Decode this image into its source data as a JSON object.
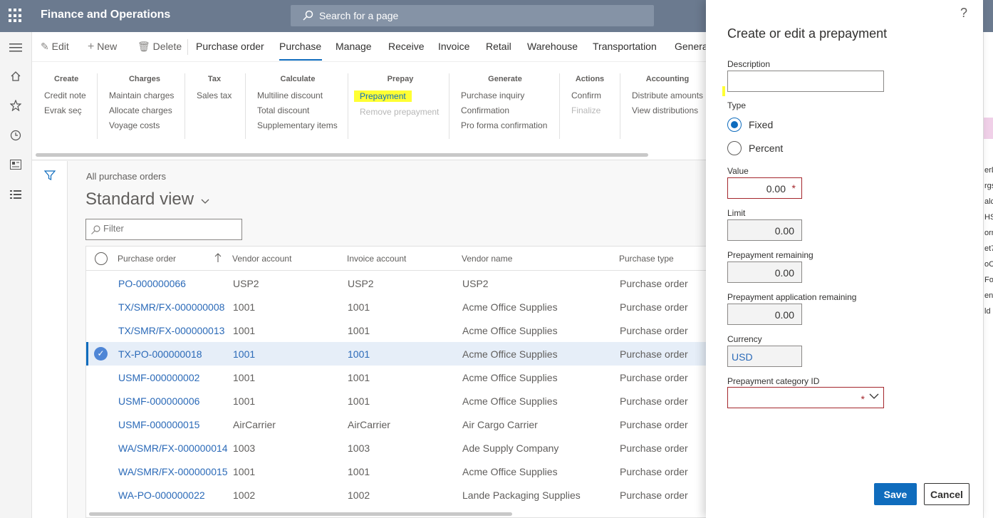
{
  "header": {
    "app_title": "Finance and Operations",
    "search_placeholder": "Search for a page"
  },
  "commands": [
    {
      "label": "Edit"
    },
    {
      "label": "New"
    },
    {
      "label": "Delete"
    }
  ],
  "tabs": [
    {
      "label": "Purchase order"
    },
    {
      "label": "Purchase"
    },
    {
      "label": "Manage"
    },
    {
      "label": "Receive"
    },
    {
      "label": "Invoice"
    },
    {
      "label": "Retail"
    },
    {
      "label": "Warehouse"
    },
    {
      "label": "Transportation"
    },
    {
      "label": "Genera"
    }
  ],
  "groups": [
    {
      "title": "Create",
      "items": [
        "Credit note",
        "Evrak seç"
      ]
    },
    {
      "title": "Charges",
      "items": [
        "Maintain charges",
        "Allocate charges",
        "Voyage costs"
      ]
    },
    {
      "title": "Tax",
      "items": [
        "Sales tax"
      ]
    },
    {
      "title": "Calculate",
      "items": [
        "Multiline discount",
        "Total discount",
        "Supplementary items"
      ]
    },
    {
      "title": "Prepay",
      "items": [
        "Prepayment",
        "Remove prepayment"
      ]
    },
    {
      "title": "Generate",
      "items": [
        "Purchase inquiry",
        "Confirmation",
        "Pro forma confirmation"
      ]
    },
    {
      "title": "Actions",
      "items": [
        "Confirm",
        "Finalize"
      ]
    },
    {
      "title": "Accounting",
      "items": [
        "Distribute amounts",
        "View distributions"
      ]
    }
  ],
  "list": {
    "breadcrumb": "All purchase orders",
    "view_title": "Standard view",
    "filter_placeholder": "Filter",
    "columns": [
      "Purchase order",
      "Vendor account",
      "Invoice account",
      "Vendor name",
      "Purchase type"
    ],
    "rows": [
      [
        "PO-000000066",
        "USP2",
        "USP2",
        "USP2",
        "Purchase order"
      ],
      [
        "TX/SMR/FX-000000008",
        "1001",
        "1001",
        "Acme Office Supplies",
        "Purchase order"
      ],
      [
        "TX/SMR/FX-000000013",
        "1001",
        "1001",
        "Acme Office Supplies",
        "Purchase order"
      ],
      [
        "TX-PO-000000018",
        "1001",
        "1001",
        "Acme Office Supplies",
        "Purchase order"
      ],
      [
        "USMF-000000002",
        "1001",
        "1001",
        "Acme Office Supplies",
        "Purchase order"
      ],
      [
        "USMF-000000006",
        "1001",
        "1001",
        "Acme Office Supplies",
        "Purchase order"
      ],
      [
        "USMF-000000015",
        "AirCarrier",
        "AirCarrier",
        "Air Cargo Carrier",
        "Purchase order"
      ],
      [
        "WA/SMR/FX-000000014",
        "1003",
        "1003",
        "Ade Supply Company",
        "Purchase order"
      ],
      [
        "WA/SMR/FX-000000015",
        "1001",
        "1001",
        "Acme Office Supplies",
        "Purchase order"
      ],
      [
        "WA-PO-000000022",
        "1002",
        "1002",
        "Lande Packaging Supplies",
        "Purchase order"
      ]
    ],
    "selected_row": 3
  },
  "right_fragments": [
    "erD",
    "rgs",
    "alc",
    "HSI",
    "orn",
    "et7",
    "oCo",
    "For",
    "ent",
    "ld"
  ],
  "dialog": {
    "help": "?",
    "title": "Create or edit a prepayment",
    "description_label": "Description",
    "description_value": "",
    "type_label": "Type",
    "type_fixed": "Fixed",
    "type_percent": "Percent",
    "value_label": "Value",
    "value": "0.00",
    "required_mark": "*",
    "limit_label": "Limit",
    "limit": "0.00",
    "remaining_label": "Prepayment remaining",
    "remaining": "0.00",
    "app_remaining_label": "Prepayment application remaining",
    "app_remaining": "0.00",
    "currency_label": "Currency",
    "currency": "USD",
    "category_label": "Prepayment category ID",
    "save": "Save",
    "cancel": "Cancel"
  }
}
